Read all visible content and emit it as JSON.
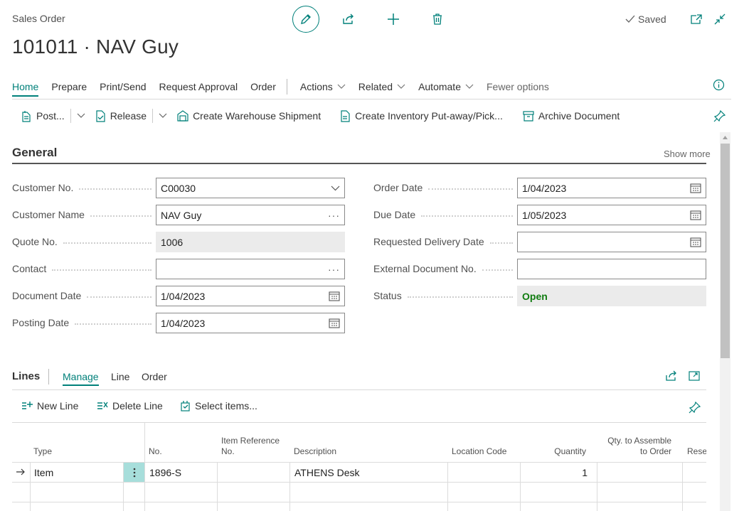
{
  "header": {
    "page_type": "Sales Order",
    "title": "101011 · NAV Guy",
    "saved_label": "Saved"
  },
  "action_tabs": [
    {
      "label": "Home"
    },
    {
      "label": "Prepare"
    },
    {
      "label": "Print/Send"
    },
    {
      "label": "Request Approval"
    },
    {
      "label": "Order"
    },
    {
      "label": "Actions"
    },
    {
      "label": "Related"
    },
    {
      "label": "Automate"
    },
    {
      "label": "Fewer options"
    }
  ],
  "toolbar": {
    "post": "Post...",
    "release": "Release",
    "create_warehouse_shipment": "Create Warehouse Shipment",
    "create_inventory_putaway": "Create Inventory Put-away/Pick...",
    "archive_document": "Archive Document"
  },
  "general": {
    "title": "General",
    "show_more": "Show more",
    "left_fields": [
      {
        "label": "Customer No.",
        "value": "C00030"
      },
      {
        "label": "Customer Name",
        "value": "NAV Guy"
      },
      {
        "label": "Quote No.",
        "value": "1006"
      },
      {
        "label": "Contact",
        "value": ""
      },
      {
        "label": "Document Date",
        "value": "1/04/2023"
      },
      {
        "label": "Posting Date",
        "value": "1/04/2023"
      }
    ],
    "right_fields": [
      {
        "label": "Order Date",
        "value": "1/04/2023"
      },
      {
        "label": "Due Date",
        "value": "1/05/2023"
      },
      {
        "label": "Requested Delivery Date",
        "value": ""
      },
      {
        "label": "External Document No.",
        "value": ""
      },
      {
        "label": "Status",
        "value": "Open"
      }
    ]
  },
  "lines": {
    "title": "Lines",
    "tabs": [
      {
        "label": "Manage"
      },
      {
        "label": "Line"
      },
      {
        "label": "Order"
      }
    ],
    "actions": {
      "new_line": "New Line",
      "delete_line": "Delete Line",
      "select_items": "Select items..."
    },
    "columns": [
      {
        "label": "Type"
      },
      {
        "label": "No."
      },
      {
        "label": "Item Reference No."
      },
      {
        "label": "Description"
      },
      {
        "label": "Location Code"
      },
      {
        "label": "Quantity"
      },
      {
        "label": "Qty. to Assemble to Order"
      },
      {
        "label": "Rese"
      }
    ],
    "rows": [
      {
        "type": "Item",
        "no": "1896-S",
        "item_ref": "",
        "description": "ATHENS Desk",
        "location": "",
        "quantity": "1",
        "qty_assemble": ""
      }
    ]
  },
  "colors": {
    "accent": "#00807a",
    "status_open": "#107c10"
  }
}
